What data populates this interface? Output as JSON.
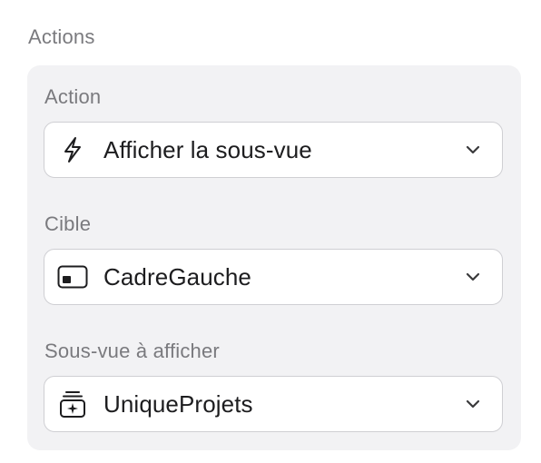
{
  "section": {
    "title": "Actions"
  },
  "fields": [
    {
      "label": "Action",
      "value": "Afficher la sous-vue",
      "icon": "lightning-icon"
    },
    {
      "label": "Cible",
      "value": "CadreGauche",
      "icon": "frame-icon"
    },
    {
      "label": "Sous-vue à afficher",
      "value": "UniqueProjets",
      "icon": "stack-sparkle-icon"
    }
  ],
  "colors": {
    "panel_bg": "#f2f2f4",
    "label": "#7a7a7e",
    "value": "#1d1d1f",
    "border": "#cfcfd3"
  }
}
